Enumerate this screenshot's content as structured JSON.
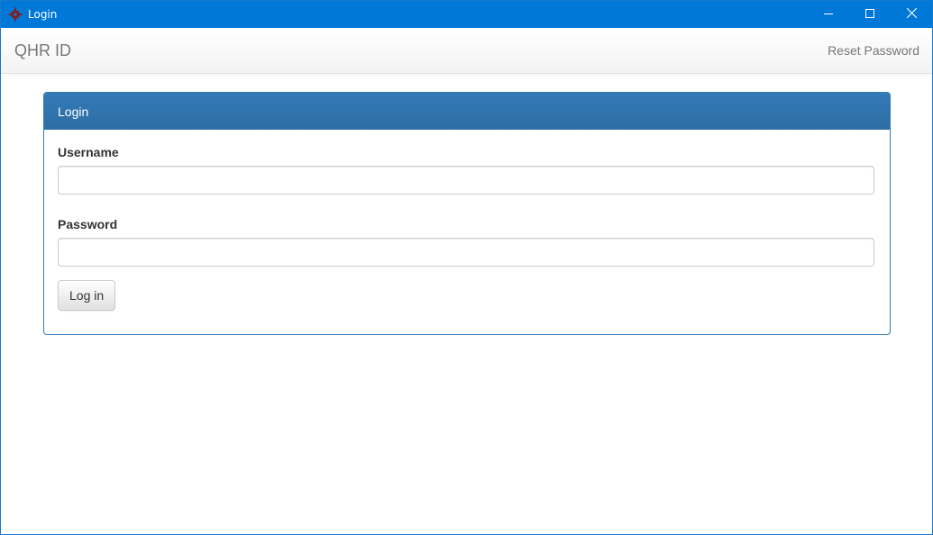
{
  "window": {
    "title": "Login",
    "icon": "qhr-logo-icon",
    "controls": {
      "minimize_icon": "minimize-icon",
      "maximize_icon": "maximize-icon",
      "close_icon": "close-icon"
    }
  },
  "navbar": {
    "brand": "QHR ID",
    "reset_link": "Reset Password"
  },
  "panel": {
    "heading": "Login",
    "username_label": "Username",
    "username_value": "",
    "password_label": "Password",
    "password_value": "",
    "submit_label": "Log in"
  },
  "colors": {
    "titlebar": "#0078d7",
    "panel_heading": "#337ab7",
    "logo": "#8b1a1a"
  }
}
